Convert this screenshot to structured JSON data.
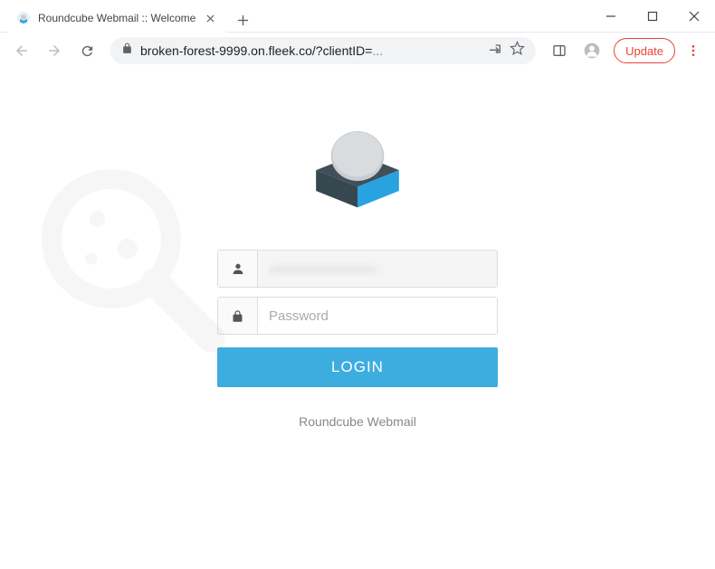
{
  "window": {
    "tab_title": "Roundcube Webmail :: Welcome"
  },
  "toolbar": {
    "url_display": "broken-forest-9999.on.fleek.co/?clientID=",
    "url_truncated": "...",
    "update_label": "Update"
  },
  "page": {
    "username_value": "————————",
    "password_placeholder": "Password",
    "login_button": "LOGIN",
    "footer": "Roundcube Webmail"
  },
  "icons": {
    "favicon_bg": "#e8f0f8",
    "logo_top": "#c9cdd1",
    "logo_left": "#37474f",
    "logo_right": "#29a3df",
    "login_btn_color": "#3dade0"
  }
}
